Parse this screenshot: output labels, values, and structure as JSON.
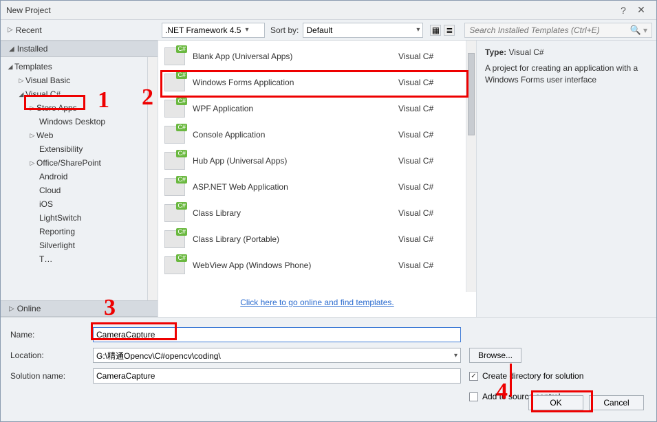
{
  "window": {
    "title": "New Project",
    "help": "?",
    "close": "✕"
  },
  "toolbar": {
    "recent": "Recent",
    "framework_label": ".NET Framework 4.5",
    "sort_label": "Sort by:",
    "sort_value": "Default",
    "search_placeholder": "Search Installed Templates (Ctrl+E)"
  },
  "sections": {
    "installed": "Installed",
    "online": "Online",
    "templates": "Templates",
    "visual_basic": "Visual Basic",
    "visual_csharp": "Visual C#",
    "store_apps": "Store Apps",
    "windows_desktop": "Windows Desktop",
    "web": "Web",
    "extensibility": "Extensibility",
    "office_sharepoint": "Office/SharePoint",
    "android": "Android",
    "cloud": "Cloud",
    "ios": "iOS",
    "lightswitch": "LightSwitch",
    "reporting": "Reporting",
    "silverlight": "Silverlight",
    "truncated": "T…"
  },
  "templates": [
    {
      "name": "Blank App (Universal Apps)",
      "lang": "Visual C#"
    },
    {
      "name": "Windows Forms Application",
      "lang": "Visual C#"
    },
    {
      "name": "WPF Application",
      "lang": "Visual C#"
    },
    {
      "name": "Console Application",
      "lang": "Visual C#"
    },
    {
      "name": "Hub App (Universal Apps)",
      "lang": "Visual C#"
    },
    {
      "name": "ASP.NET Web Application",
      "lang": "Visual C#"
    },
    {
      "name": "Class Library",
      "lang": "Visual C#"
    },
    {
      "name": "Class Library (Portable)",
      "lang": "Visual C#"
    },
    {
      "name": "WebView App (Windows Phone)",
      "lang": "Visual C#"
    }
  ],
  "onlinelink": "Click here to go online and find templates.",
  "info": {
    "type_label": "Type:",
    "type_value": "Visual C#",
    "description": "A project for creating an application with a Windows Forms user interface"
  },
  "form": {
    "name_label": "Name:",
    "name_value": "CameraCapture",
    "location_label": "Location:",
    "location_value": "G:\\精通Opencv\\C#opencv\\coding\\",
    "solution_label": "Solution name:",
    "solution_value": "CameraCapture",
    "browse": "Browse...",
    "create_dir": "Create directory for solution",
    "add_src": "Add to source control",
    "ok": "OK",
    "cancel": "Cancel"
  },
  "annotations": {
    "n1": "1",
    "n2": "2",
    "n3": "3",
    "n4": "4"
  }
}
